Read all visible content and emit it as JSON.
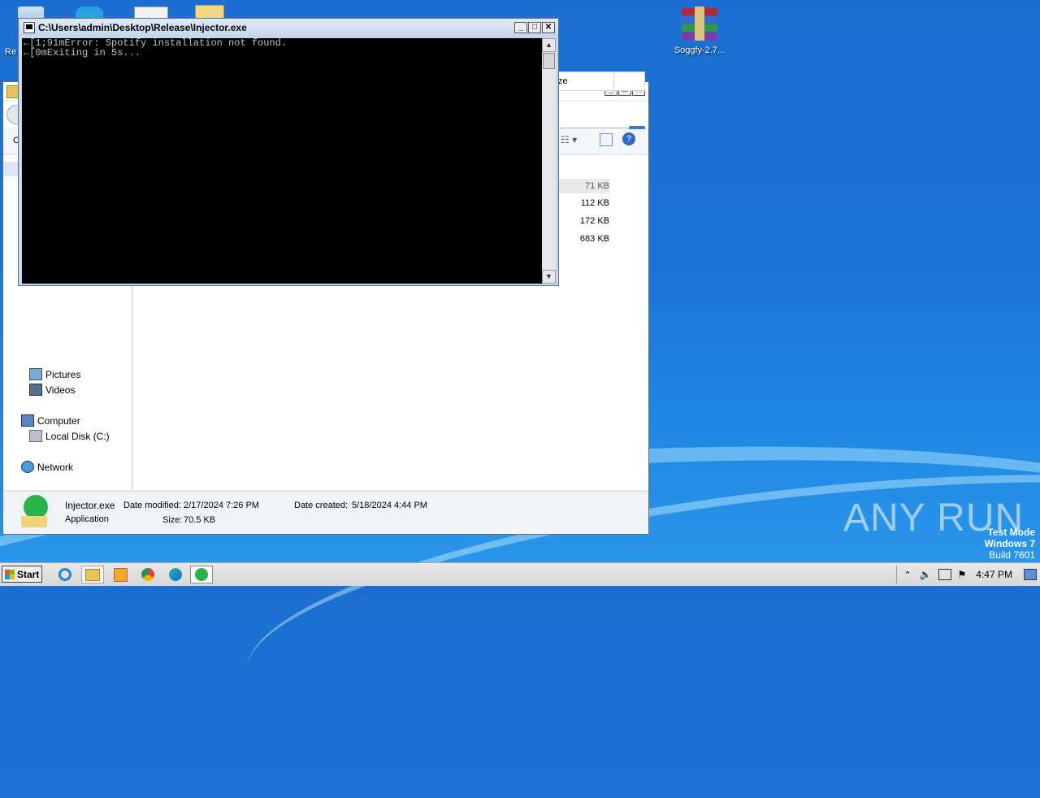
{
  "desktop": {
    "icons": [
      {
        "label": "Re",
        "name": "recycle-bin"
      },
      {
        "label": "Soggfy-2.7...",
        "name": "winrar-archive"
      }
    ]
  },
  "console": {
    "title": "C:\\Users\\admin\\Desktop\\Release\\Injector.exe",
    "lines": [
      "←[1;91mError: Spotify installation not found.",
      "←[0mExiting in 5s..."
    ]
  },
  "explorer": {
    "column_header": "ze",
    "sizes": [
      "71 KB",
      "112 KB",
      "172 KB",
      "683 KB"
    ],
    "nav": {
      "pictures": "Pictures",
      "videos": "Videos",
      "computer": "Computer",
      "local_disk": "Local Disk (C:)",
      "network": "Network"
    },
    "toolbar_partial": "C",
    "details": {
      "filename": "Injector.exe",
      "type": "Application",
      "date_modified_label": "Date modified:",
      "date_modified": "2/17/2024 7:26 PM",
      "size_label": "Size:",
      "size": "70.5 KB",
      "date_created_label": "Date created:",
      "date_created": "5/18/2024 4:44 PM"
    }
  },
  "watermark": {
    "text": "ANY RUN",
    "test_mode": "Test Mode",
    "os": "Windows 7",
    "build": "Build 7601"
  },
  "taskbar": {
    "start_label": "Start",
    "clock": "4:47 PM",
    "apps": [
      "internet-explorer-icon",
      "explorer-icon",
      "media-player-icon",
      "chrome-icon",
      "edge-icon",
      "injector-app-icon"
    ]
  }
}
